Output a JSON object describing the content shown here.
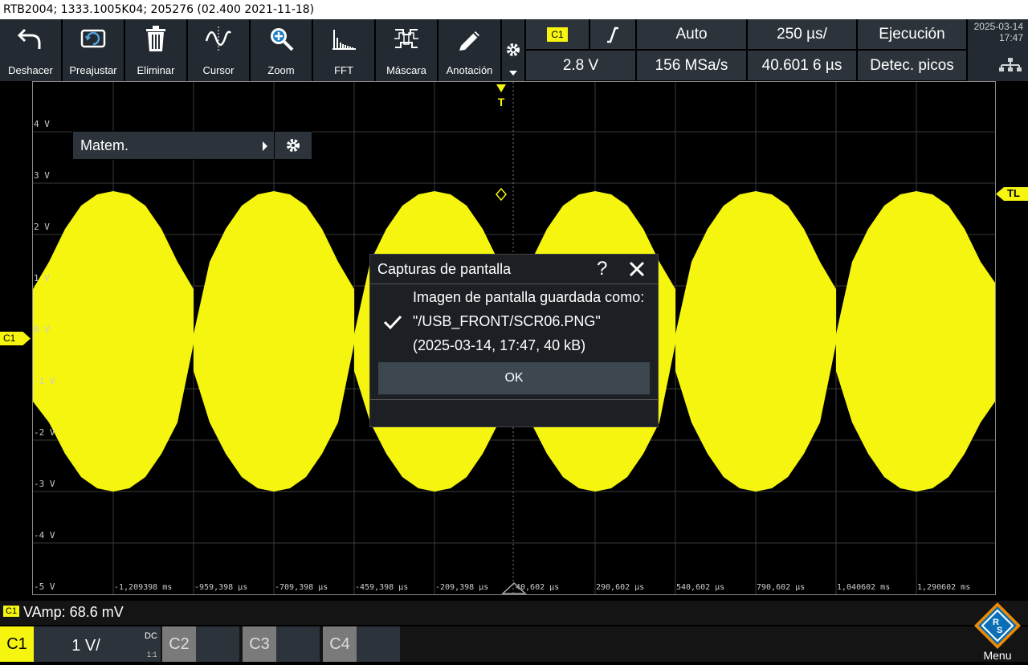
{
  "title_bar": "RTB2004; 1333.1005K04; 205276 (02.400 2021-11-18)",
  "toolbar": {
    "undo": "Deshacer",
    "preset": "Preajustar",
    "delete": "Eliminar",
    "cursor": "Cursor",
    "zoom": "Zoom",
    "fft": "FFT",
    "mask": "Máscara",
    "annotation": "Anotación"
  },
  "trigger": {
    "source": "C1",
    "level": "2.8 V",
    "mode": "Auto",
    "sample_rate": "156 MSa/s",
    "timebase": "250 µs/",
    "position": "40.601 6 µs",
    "run_state": "Ejecución",
    "acquisition": "Detec. picos"
  },
  "datetime": {
    "date": "2025-03-14",
    "time": "17:47"
  },
  "y_axis_labels": [
    "4 V",
    "3 V",
    "2 V",
    "1 V",
    "0 V",
    "-1 V",
    "-2 V",
    "-3 V",
    "-4 V",
    "-5 V"
  ],
  "x_axis_labels": [
    "-1,209398 ms",
    "-959,398 µs",
    "-709,398 µs",
    "-459,398 µs",
    "-209,398 µs",
    "40,602 µs",
    "290,602 µs",
    "540,602 µs",
    "790,602 µs",
    "1,040602 ms",
    "1,290602 ms"
  ],
  "markers": {
    "trigger_top": "T",
    "trigger_level": "TL",
    "channel": "C1"
  },
  "math_menu": {
    "label": "Matem."
  },
  "dialog": {
    "title": "Capturas de pantalla",
    "help": "?",
    "line1": "Imagen de pantalla guardada como:",
    "line2": "\"/USB_FRONT/SCR06.PNG\"",
    "line3": "(2025-03-14, 17:47, 40 kB)",
    "ok": "OK"
  },
  "measurement": {
    "channel": "C1",
    "text": "VAmp: 68.6 mV"
  },
  "channels": [
    {
      "name": "C1",
      "scale": "1 V/",
      "coupling": "DC",
      "ratio": "1:1",
      "active": true
    },
    {
      "name": "C2",
      "active": false
    },
    {
      "name": "C3",
      "active": false
    },
    {
      "name": "C4",
      "active": false
    }
  ],
  "menu_label": "Menu",
  "colors": {
    "trace": "#f5f50f",
    "panel": "#2c333a",
    "accent": "#f5f50f"
  }
}
